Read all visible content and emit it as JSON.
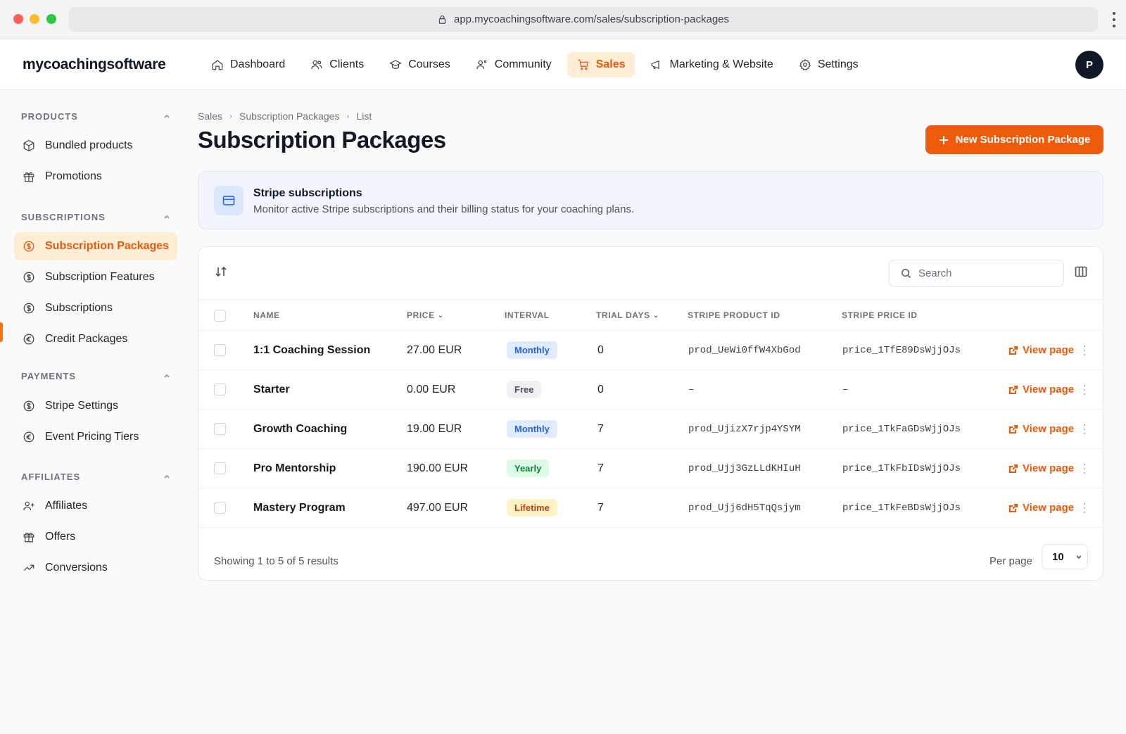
{
  "browser": {
    "url": "app.mycoachingsoftware.com/sales/subscription-packages"
  },
  "brand": "mycoachingsoftware",
  "nav": {
    "items": [
      {
        "label": "Dashboard",
        "icon": "home-icon"
      },
      {
        "label": "Clients",
        "icon": "users-icon"
      },
      {
        "label": "Courses",
        "icon": "graduation-cap-icon"
      },
      {
        "label": "Community",
        "icon": "user-group-icon"
      },
      {
        "label": "Sales",
        "icon": "cart-icon",
        "active": true
      },
      {
        "label": "Marketing & Website",
        "icon": "megaphone-icon"
      },
      {
        "label": "Settings",
        "icon": "gear-icon"
      }
    ],
    "avatar": "P"
  },
  "sidebar": {
    "sections": [
      {
        "title": "PRODUCTS",
        "items": [
          {
            "label": "Bundled products",
            "icon": "cube-icon"
          },
          {
            "label": "Promotions",
            "icon": "gift-icon"
          }
        ]
      },
      {
        "title": "SUBSCRIPTIONS",
        "items": [
          {
            "label": "Subscription Packages",
            "icon": "dollar-circle-icon",
            "active": true
          },
          {
            "label": "Subscription Features",
            "icon": "dollar-circle-icon"
          },
          {
            "label": "Subscriptions",
            "icon": "dollar-circle-icon"
          },
          {
            "label": "Credit Packages",
            "icon": "euro-circle-icon"
          }
        ]
      },
      {
        "title": "PAYMENTS",
        "items": [
          {
            "label": "Stripe Settings",
            "icon": "dollar-circle-icon"
          },
          {
            "label": "Event Pricing Tiers",
            "icon": "euro-circle-icon"
          }
        ]
      },
      {
        "title": "AFFILIATES",
        "items": [
          {
            "label": "Affiliates",
            "icon": "user-plus-icon"
          },
          {
            "label": "Offers",
            "icon": "gift-icon"
          },
          {
            "label": "Conversions",
            "icon": "trending-up-icon"
          }
        ]
      }
    ]
  },
  "breadcrumb": [
    "Sales",
    "Subscription Packages",
    "List"
  ],
  "page": {
    "title": "Subscription Packages",
    "new_button": "New Subscription Package"
  },
  "info": {
    "title": "Stripe subscriptions",
    "description": "Monitor active Stripe subscriptions and their billing status for your coaching plans."
  },
  "table": {
    "search_placeholder": "Search",
    "columns": [
      "NAME",
      "PRICE",
      "INTERVAL",
      "TRIAL DAYS",
      "STRIPE PRODUCT ID",
      "STRIPE PRICE ID"
    ],
    "rows": [
      {
        "name": "1:1 Coaching Session",
        "price": "27.00 EUR",
        "interval": "Monthly",
        "interval_color": "blue",
        "trial_days": "0",
        "product_id": "prod_UeWi0ffW4XbGod",
        "price_id": "price_1TfE89DsWjjOJs",
        "action": "View page"
      },
      {
        "name": "Starter",
        "price": "0.00 EUR",
        "interval": "Free",
        "interval_color": "gray",
        "trial_days": "0",
        "product_id": "–",
        "price_id": "–",
        "action": "View page"
      },
      {
        "name": "Growth Coaching",
        "price": "19.00 EUR",
        "interval": "Monthly",
        "interval_color": "blue",
        "trial_days": "7",
        "product_id": "prod_UjizX7rjp4YSYM",
        "price_id": "price_1TkFaGDsWjjOJs",
        "action": "View page"
      },
      {
        "name": "Pro Mentorship",
        "price": "190.00 EUR",
        "interval": "Yearly",
        "interval_color": "green",
        "trial_days": "7",
        "product_id": "prod_Ujj3GzLLdKHIuH",
        "price_id": "price_1TkFbIDsWjjOJs",
        "action": "View page"
      },
      {
        "name": "Mastery Program",
        "price": "497.00 EUR",
        "interval": "Lifetime",
        "interval_color": "yellow",
        "trial_days": "7",
        "product_id": "prod_Ujj6dH5TqQsjym",
        "price_id": "price_1TkFeBDsWjjOJs",
        "action": "View page"
      }
    ],
    "footer": "Showing 1 to 5 of 5 results",
    "per_page_label": "Per page",
    "per_page_value": "10"
  },
  "colors": {
    "accent": "#f05a0c",
    "accent_soft": "#ffedd5",
    "info_bg": "#f1f5fd"
  }
}
